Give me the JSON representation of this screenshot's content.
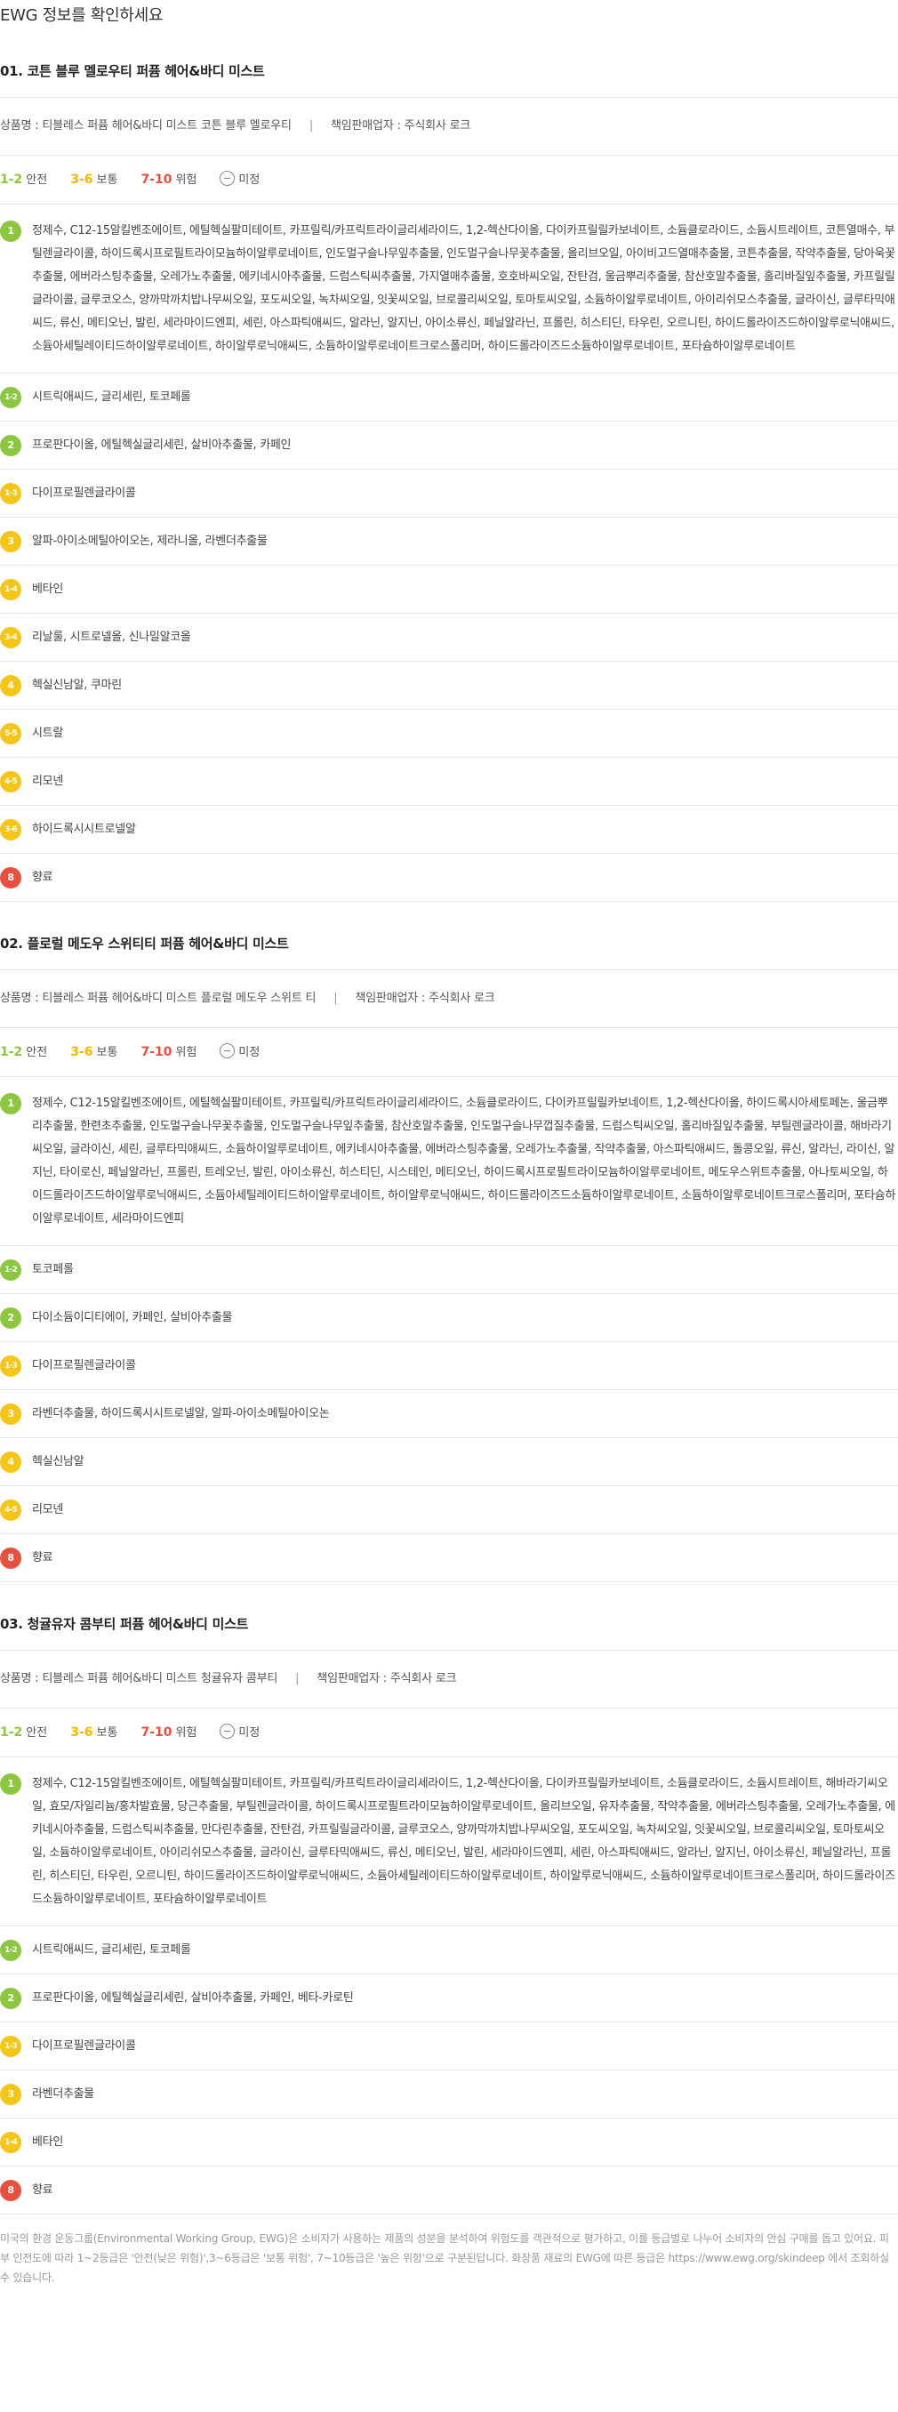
{
  "page_title": "EWG 정보를 확인하세요",
  "legend": {
    "safe_range": "1-2",
    "safe_label": "안전",
    "mid_range": "3-6",
    "mid_label": "보통",
    "high_range": "7-10",
    "high_label": "위험",
    "unknown_label": "미정"
  },
  "colors": {
    "green": "#8dc63f",
    "yellow": "#f5c518",
    "red": "#e8503e"
  },
  "products": [
    {
      "title": "01. 코튼 블루 멜로우티 퍼퓸 헤어&바디 미스트",
      "product_name": "상품명 : 티블레스 퍼퓸 헤어&바디 미스트 코튼 블루 멜로우티",
      "seller": "책임판매업자 : 주식회사 로크",
      "rows": [
        {
          "grade": "1",
          "color": "green",
          "text": "정제수, C12-15알킬벤조에이트, 에틸헥실팔미테이트, 카프릴릭/카프릭트라이글리세라이드, 1,2-헥산다이올, 다이카프릴릴카보네이트, 소듐클로라이드, 소듐시트레이트, 코튼열매수, 부틸렌글라이콜, 하이드록시프로필트라이모늄하이알루로네이트, 인도멀구슬나무잎추출물, 인도멀구슬나무꽃추출물, 올리브오일, 아이비고드열매추출물, 코튼추출물, 작약추출물, 당아욱꽃추출물, 에버라스팅추출물, 오레가노추출물, 에키네시아추출물, 드럼스틱씨추출물, 가지열매추출물, 호호바씨오일, 잔탄검, 울금뿌리추출물, 참산호말추출물, 홀리바질잎추출물, 카프릴릴글라이콜, 글루코오스, 양까막까치밥나무씨오일, 포도씨오일, 녹차씨오일, 잇꽃씨오일, 브로콜리씨오일, 토마토씨오일, 소듐하이알루로네이트, 아이리쉬모스추출물, 글라이신, 글루타믹애씨드, 류신, 메티오닌, 발린, 세라마이드엔피, 세린, 아스파틱애씨드, 알라닌, 알지닌, 아이소류신, 페닐알라닌, 프롤린, 히스티딘, 타우린, 오르니틴, 하이드롤라이즈드하이알루로닉애씨드, 소듐아세틸레이티드하이알루로네이트, 하이알루로닉애씨드, 소듐하이알루로네이트크로스폴리머, 하이드롤라이즈드소듐하이알루로네이트, 포타슘하이알루로네이트"
        },
        {
          "grade": "1-2",
          "color": "green",
          "text": "시트릭애씨드, 글리세린, 토코페롤"
        },
        {
          "grade": "2",
          "color": "green",
          "text": "프로판다이올, 에틸헥실글리세린, 살비아추출물, 카페인"
        },
        {
          "grade": "1-3",
          "color": "yellow",
          "text": "다이프로필렌글라이콜"
        },
        {
          "grade": "3",
          "color": "yellow",
          "text": "알파-아이소메틸아이오논, 제라니올, 라벤더추출물"
        },
        {
          "grade": "1-4",
          "color": "yellow",
          "text": "베타인"
        },
        {
          "grade": "3-4",
          "color": "yellow",
          "text": "리날룰, 시트로넬올, 신나밀알코올"
        },
        {
          "grade": "4",
          "color": "yellow",
          "text": "헥실신남알, 쿠마린"
        },
        {
          "grade": "5-5",
          "color": "yellow",
          "text": "시트랄"
        },
        {
          "grade": "4-5",
          "color": "yellow",
          "text": "리모넨"
        },
        {
          "grade": "3-6",
          "color": "yellow",
          "text": "하이드록시시트로넬알"
        },
        {
          "grade": "8",
          "color": "red",
          "text": "향료"
        }
      ]
    },
    {
      "title": "02. 플로럴 메도우 스위티티 퍼퓸 헤어&바디 미스트",
      "product_name": "상품명 : 티블레스 퍼퓸 헤어&바디 미스트 플로럴 메도우 스위트 티",
      "seller": "책임판매업자 : 주식회사 로크",
      "rows": [
        {
          "grade": "1",
          "color": "green",
          "text": "정제수, C12-15알킬벤조에이트, 에틸헥실팔미테이트, 카프릴릭/카프릭트라이글리세라이드, 소듐클로라이드, 다이카프릴릴카보네이트, 1,2-헥산다이올, 하이드록시아세토페논, 울금뿌리추출물, 한련초추출물, 인도멀구슬나무꽃추출물, 인도멀구슬나무잎추출물, 참산호말추출물, 인도멀구슬나무껍질추출물, 드럼스틱씨오일, 홀리바질잎추출물, 부틸렌글라이콜, 해바라기씨오일, 글라이신, 세린, 글루타믹애씨드, 소듐하이알루로네이트, 에키네시아추출물, 에버라스팅추출물, 오레가노추출물, 작약추출물, 아스파틱애씨드, 돌콩오일, 류신, 알라닌, 라이신, 알지닌, 타이로신, 페닐알라닌, 프롤린, 트레오닌, 발린, 아이소류신, 히스티딘, 시스테인, 메티오닌, 하이드록시프로필트라이모늄하이알루로네이트, 메도우스위트추출물, 아나토씨오일, 하이드롤라이즈드하이알루로닉애씨드, 소듐아세틸레이티드하이알루로네이트, 하이알루로닉애씨드, 하이드롤라이즈드소듐하이알루로네이트, 소듐하이알루로네이트크로스폴리머, 포타슘하이알루로네이트, 세라마이드엔피"
        },
        {
          "grade": "1-2",
          "color": "green",
          "text": "토코페롤"
        },
        {
          "grade": "2",
          "color": "green",
          "text": "다이소듐이디티에이, 카페인, 살비아추출물"
        },
        {
          "grade": "1-3",
          "color": "yellow",
          "text": "다이프로필렌글라이콜"
        },
        {
          "grade": "3",
          "color": "yellow",
          "text": "라벤더추출물, 하이드록시시트로넬알, 알파-아이소메틸아이오논"
        },
        {
          "grade": "4",
          "color": "yellow",
          "text": "헥실신남알"
        },
        {
          "grade": "4-5",
          "color": "yellow",
          "text": "리모넨"
        },
        {
          "grade": "8",
          "color": "red",
          "text": "향료"
        }
      ]
    },
    {
      "title": "03. 청귤유자 콤부티 퍼퓸 헤어&바디 미스트",
      "product_name": "상품명 : 티블레스 퍼퓸 헤어&바디 미스트 청귤유자 콤부티",
      "seller": "책임판매업자 : 주식회사 로크",
      "rows": [
        {
          "grade": "1",
          "color": "green",
          "text": "정제수, C12-15알킬벤조에이트, 에틸헥실팔미테이트, 카프릴릭/카프릭트라이글리세라이드, 1,2-헥산다이올, 다이카프릴릴카보네이트, 소듐클로라이드, 소듐시트레이트, 해바라기씨오일, 효모/자일리늄/홍차발효물, 당근추출물, 부틸렌글라이콜, 하이드록시프로필트라이모늄하이알루로네이트, 올리브오일, 유자추출물, 작약추출물, 에버라스팅추출물, 오레가노추출물, 에키네시아추출물, 드럼스틱씨추출물, 만다린추출물, 잔탄검, 카프릴릴글라이콜, 글루코오스, 양까막까치밥나무씨오일, 포도씨오일, 녹차씨오일, 잇꽃씨오일, 브로콜리씨오일, 토마토씨오일, 소듐하이알루로네이트, 아이리쉬모스추출물, 글라이신, 글루타믹애씨드, 류신, 메티오닌, 발린, 세라마이드엔피, 세린, 아스파틱애씨드, 알라닌, 알지닌, 아이소류신, 페닐알라닌, 프롤린, 히스티딘, 타우린, 오르니틴, 하이드롤라이즈드하이알루로닉애씨드, 소듐아세틸레이티드하이알루로네이트, 하이알루로닉애씨드, 소듐하이알루로네이트크로스폴리머, 하이드롤라이즈드소듐하이알루로네이트, 포타슘하이알루로네이트"
        },
        {
          "grade": "1-2",
          "color": "green",
          "text": "시트릭애씨드, 글리세린, 토코페롤"
        },
        {
          "grade": "2",
          "color": "green",
          "text": "프로판다이올, 에틸헥실글리세린, 살비아추출물, 카페인, 베타-카로틴"
        },
        {
          "grade": "1-3",
          "color": "yellow",
          "text": "다이프로필렌글라이콜"
        },
        {
          "grade": "3",
          "color": "yellow",
          "text": "라벤더추출물"
        },
        {
          "grade": "1-4",
          "color": "yellow",
          "text": "베타인"
        },
        {
          "grade": "8",
          "color": "red",
          "text": "향료"
        }
      ]
    }
  ],
  "footnote": "미국의 환경 운동그룹(Environmental Working Group, EWG)은 소비자가 사용하는 제품의 성분을 분석하여 위험도를 객관적으로 평가하고, 이를 등급별로 나누어 소비자의 안심 구매를 돕고 있어요. 피부 인전도에 따라 1~2등급은 '안전(낮은 위험)',3~6등급은 '보통 위험', 7~10등급은 '높은 위험'으로 구분된답니다. 화장품 재료의 EWG에 따른 등급은 https://www.ewg.org/skindeep 에서 조회하실 수 있습니다."
}
